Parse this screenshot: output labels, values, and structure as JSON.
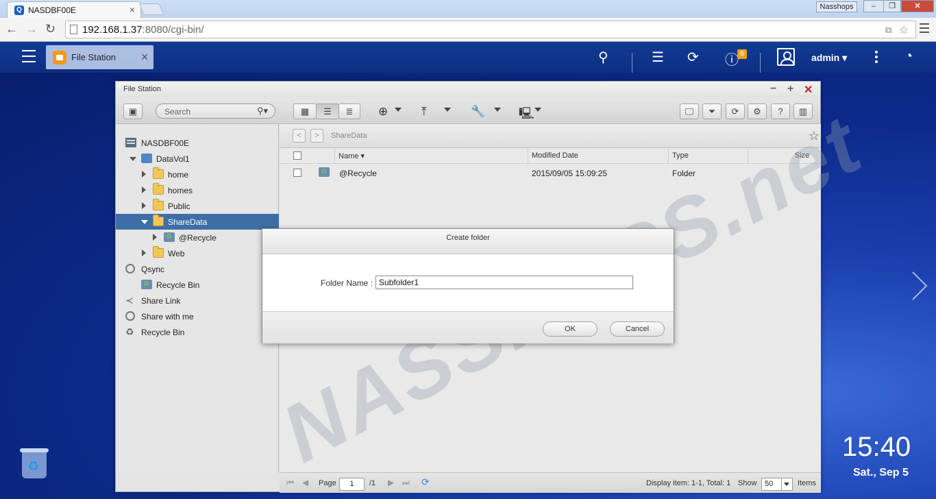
{
  "browser": {
    "tab_title": "NASDBF00E",
    "user_chip": "Nasshops",
    "url_main": "192.168.1.37",
    "url_rest": ":8080/cgi-bin/"
  },
  "qts": {
    "app_tab_title": "File Station",
    "notification_count": "6",
    "username": "admin"
  },
  "window": {
    "title": "File Station",
    "search_placeholder": "Search"
  },
  "sidebar": {
    "items": [
      {
        "label": "NASDBF00E"
      },
      {
        "label": "DataVol1"
      },
      {
        "label": "home"
      },
      {
        "label": "homes"
      },
      {
        "label": "Public"
      },
      {
        "label": "ShareData"
      },
      {
        "label": "@Recycle"
      },
      {
        "label": "Web"
      },
      {
        "label": "Qsync"
      },
      {
        "label": "Recycle Bin"
      },
      {
        "label": "Share Link"
      },
      {
        "label": "Share with me"
      },
      {
        "label": "Recycle Bin"
      }
    ]
  },
  "main": {
    "path": "ShareData",
    "columns": {
      "name": "Name",
      "modified": "Modified Date",
      "type": "Type",
      "size": "Size"
    },
    "rows": [
      {
        "name": "@Recycle",
        "modified": "2015/09/05 15:09:25",
        "type": "Folder",
        "size": ""
      }
    ]
  },
  "statusbar": {
    "page_label": "Page",
    "page_value": "1",
    "page_total": "/1",
    "display_info": "Display item: 1-1, Total: 1",
    "show_label": "Show",
    "show_value": "50",
    "items_label": "Items"
  },
  "dialog": {
    "title": "Create folder",
    "label": "Folder Name :",
    "input_value": "Subfolder1",
    "ok_label": "OK",
    "cancel_label": "Cancel"
  },
  "desktop": {
    "time": "15:40",
    "date": "Sat., Sep 5"
  },
  "watermark": "NASSHOPS.net",
  "colors": {
    "accent": "#3d6fa6",
    "taskbar": "#123a96",
    "badge": "#f0a21b"
  }
}
